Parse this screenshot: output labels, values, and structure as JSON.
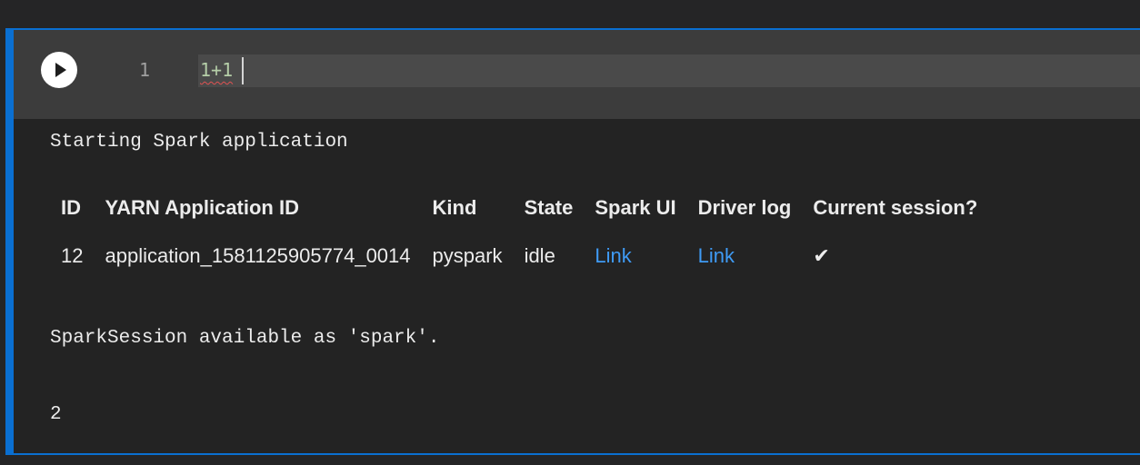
{
  "cell": {
    "line_number": "1",
    "code": "1+1"
  },
  "output": {
    "starting_text": "Starting Spark application",
    "table": {
      "headers": [
        "ID",
        "YARN Application ID",
        "Kind",
        "State",
        "Spark UI",
        "Driver log",
        "Current session?"
      ],
      "row": {
        "id": "12",
        "yarn_app_id": "application_1581125905774_0014",
        "kind": "pyspark",
        "state": "idle",
        "spark_ui": "Link",
        "driver_log": "Link",
        "current_session": "✔"
      }
    },
    "session_text": "SparkSession available as 'spark'.",
    "result": "2"
  },
  "colors": {
    "accent": "#0a6fd1",
    "link": "#3f9bf5"
  }
}
